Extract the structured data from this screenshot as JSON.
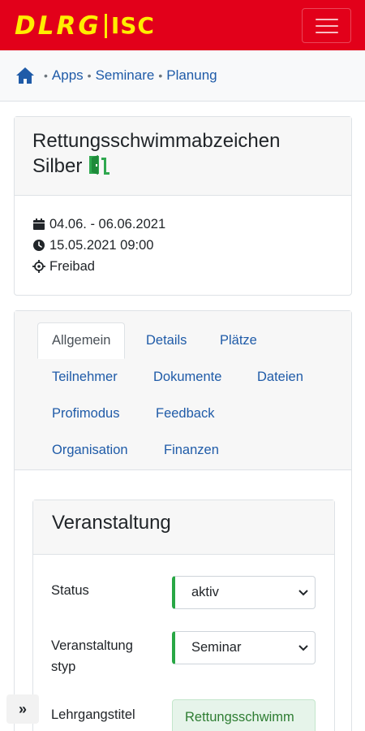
{
  "header": {
    "logo_text": "DLRG",
    "logo_sub": "ISC",
    "brand_color": "#e2001a",
    "logo_color": "#ffed00",
    "menu_icon": "hamburger-icon"
  },
  "breadcrumb": {
    "home_icon": "home-icon",
    "items": [
      "Apps",
      "Seminare",
      "Planung"
    ]
  },
  "event": {
    "title": "Rettungsschwimmabzeichen Silber",
    "title_icon": "door-open-icon",
    "date_range": "04.06. - 06.06.2021",
    "deadline": "15.05.2021 09:00",
    "location": "Freibad",
    "icons": [
      "calendar-icon",
      "clock-icon",
      "crosshair-icon"
    ]
  },
  "tabs": [
    "Allgemein",
    "Details",
    "Plätze",
    "Teilnehmer",
    "Dokumente",
    "Dateien",
    "Profimodus",
    "Feedback",
    "Organisation",
    "Finanzen"
  ],
  "active_tab": "Allgemein",
  "form": {
    "section_title": "Veranstaltung",
    "status_label": "Status",
    "status_value": "aktiv",
    "type_label_line1": "Veranstaltung",
    "type_label_line2": "styp",
    "type_value": "Seminar",
    "course_title_label": "Lehrgangstitel",
    "course_title_value": "Rettungsschwimm",
    "valid_color": "#28a745"
  },
  "sidebar_toggle": "»"
}
